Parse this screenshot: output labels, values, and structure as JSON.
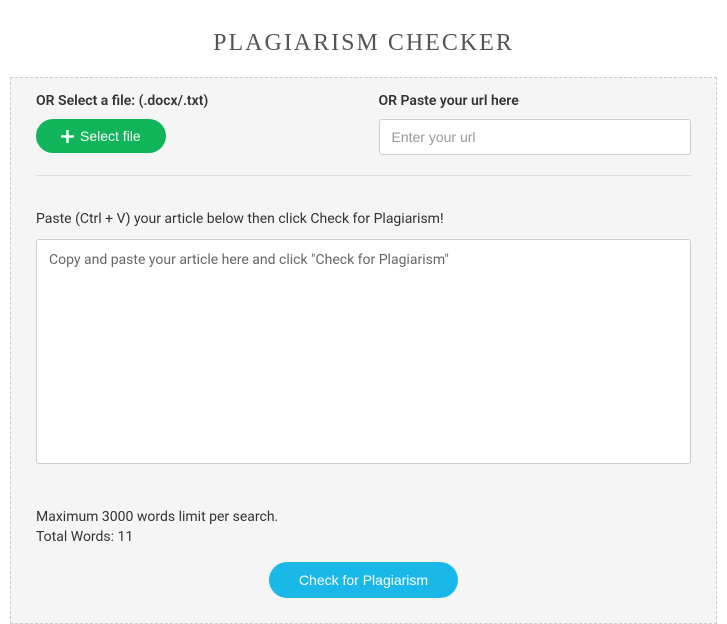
{
  "title": "PLAGIARISM CHECKER",
  "fileSection": {
    "label": "OR Select a file: (.docx/.txt)",
    "buttonLabel": "Select file"
  },
  "urlSection": {
    "label": "OR Paste your url here",
    "placeholder": "Enter your url"
  },
  "articleSection": {
    "label": "Paste (Ctrl + V) your article below then click Check for Plagiarism!",
    "placeholder": "Copy and paste your article here and click \"Check for Plagiarism\""
  },
  "info": {
    "maxWords": "Maximum 3000 words limit per search.",
    "totalWords": "Total Words: 11"
  },
  "checkButton": "Check for Plagiarism"
}
